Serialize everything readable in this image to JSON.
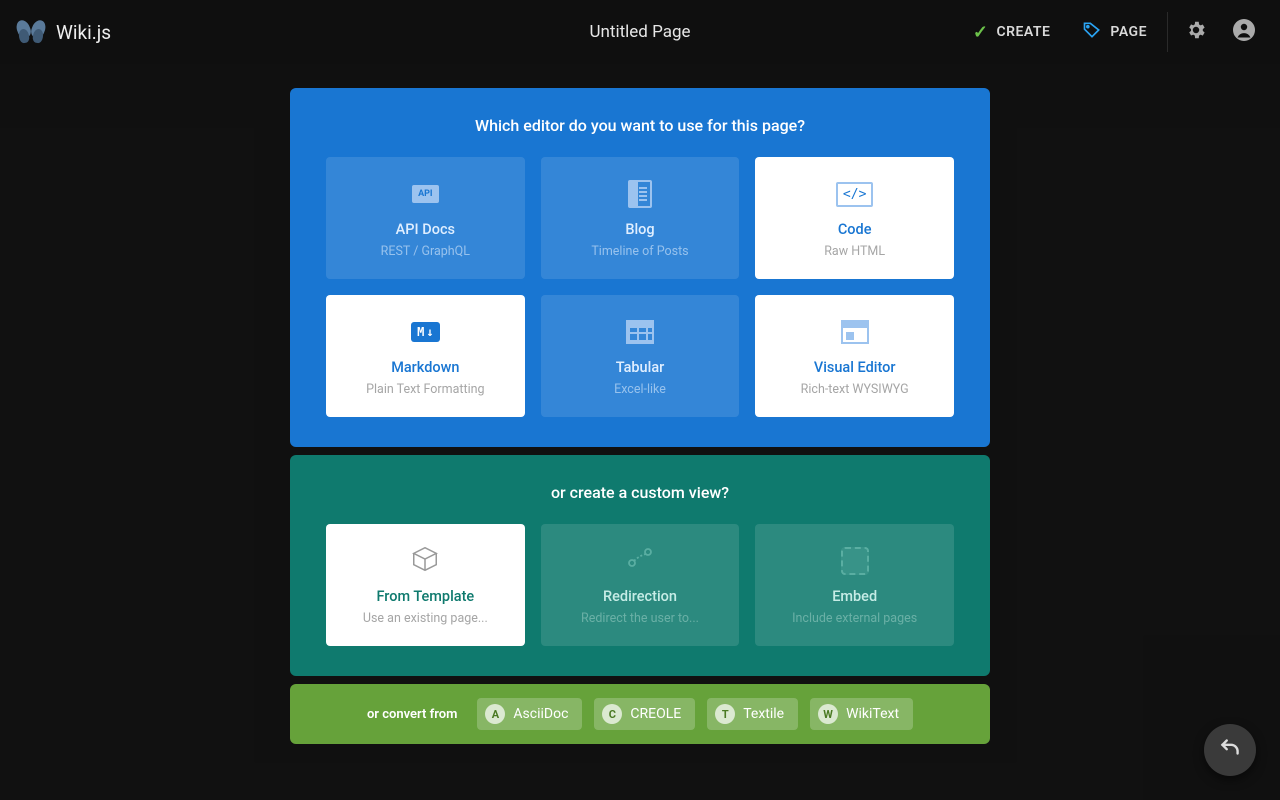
{
  "brand": "Wiki.js",
  "page_title": "Untitled Page",
  "toolbar": {
    "create": "CREATE",
    "page": "PAGE"
  },
  "editor_prompt": "Which editor do you want to use for this page?",
  "editors": [
    {
      "id": "api-docs",
      "title": "API Docs",
      "sub": "REST / GraphQL",
      "white": false,
      "icon": "api"
    },
    {
      "id": "blog",
      "title": "Blog",
      "sub": "Timeline of Posts",
      "white": false,
      "icon": "blog"
    },
    {
      "id": "code",
      "title": "Code",
      "sub": "Raw HTML",
      "white": true,
      "icon": "code"
    },
    {
      "id": "markdown",
      "title": "Markdown",
      "sub": "Plain Text Formatting",
      "white": true,
      "icon": "md"
    },
    {
      "id": "tabular",
      "title": "Tabular",
      "sub": "Excel-like",
      "white": false,
      "icon": "table"
    },
    {
      "id": "visual-editor",
      "title": "Visual Editor",
      "sub": "Rich-text WYSIWYG",
      "white": true,
      "icon": "ve"
    }
  ],
  "custom_prompt": "or create a custom view?",
  "customs": [
    {
      "id": "from-template",
      "title": "From Template",
      "sub": "Use an existing page...",
      "white": true,
      "icon": "tmpl"
    },
    {
      "id": "redirection",
      "title": "Redirection",
      "sub": "Redirect the user to...",
      "white": false,
      "icon": "redir"
    },
    {
      "id": "embed",
      "title": "Embed",
      "sub": "Include external pages",
      "white": false,
      "icon": "embed"
    }
  ],
  "convert_label": "or convert from",
  "converters": [
    {
      "id": "asciidoc",
      "label": "AsciiDoc",
      "badge": "A"
    },
    {
      "id": "creole",
      "label": "CREOLE",
      "badge": "C"
    },
    {
      "id": "textile",
      "label": "Textile",
      "badge": "T"
    },
    {
      "id": "wikitext",
      "label": "WikiText",
      "badge": "W"
    }
  ]
}
